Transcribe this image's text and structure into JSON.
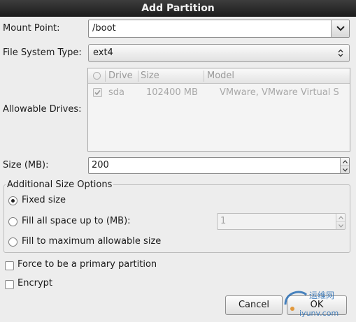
{
  "dialog": {
    "title": "Add Partition"
  },
  "mount_point": {
    "label": "Mount Point:",
    "value": "/boot",
    "icon": "chevron-down-icon"
  },
  "fs_type": {
    "label": "File System Type:",
    "value": "ext4",
    "icon": "updown-arrows-icon"
  },
  "drives": {
    "label": "Allowable Drives:",
    "columns": [
      "Drive",
      "Size",
      "Model"
    ],
    "rows": [
      {
        "checked": true,
        "drive": "sda",
        "size": "102400 MB",
        "model": "VMware, VMware Virtual S"
      }
    ]
  },
  "size": {
    "label": "Size (MB):",
    "value": "200"
  },
  "size_options": {
    "title": "Additional Size Options",
    "fixed_label": "Fixed size",
    "fill_upto_label": "Fill all space up to (MB):",
    "fill_upto_value": "1",
    "fill_max_label": "Fill to maximum allowable size",
    "selected": "fixed"
  },
  "primary": {
    "label": "Force to be a primary partition",
    "checked": false
  },
  "encrypt": {
    "label": "Encrypt",
    "checked": false
  },
  "buttons": {
    "cancel": "Cancel",
    "ok": "OK"
  },
  "watermark": {
    "text": "运维网",
    "sub": "iyunv.com"
  },
  "colors": {
    "titlebar": "#2a2a2a",
    "background": "#ededed",
    "watermark": "#2a6fb5"
  }
}
